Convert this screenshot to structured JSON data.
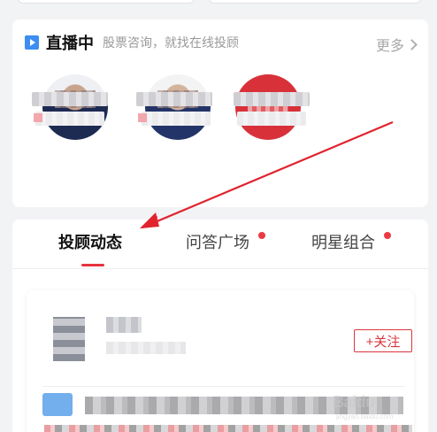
{
  "live_section": {
    "title": "直播中",
    "subtitle": "股票咨询，就找在线投顾",
    "more": "更多",
    "advisors": [
      {
        "name": "",
        "avatar_color": "#1d2a52"
      },
      {
        "name": "",
        "avatar_color": "#233468"
      },
      {
        "name": "",
        "avatar_color": "#d8313a"
      }
    ]
  },
  "tabs": [
    {
      "label": "投顾动态",
      "active": true,
      "has_dot": false
    },
    {
      "label": "问答广场",
      "active": false,
      "has_dot": true
    },
    {
      "label": "明星组合",
      "active": false,
      "has_dot": true
    }
  ],
  "post": {
    "follow_label": "+关注"
  },
  "colors": {
    "accent": "#e5333c",
    "live_icon": "#3d8ef0",
    "background": "#f2f3f5"
  },
  "watermark": {
    "brand": "Baidu",
    "sub": "jingyan.baidu.com"
  }
}
